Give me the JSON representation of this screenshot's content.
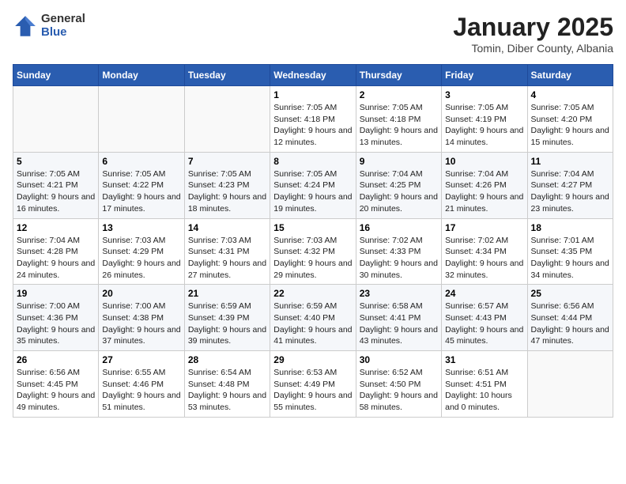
{
  "logo": {
    "general": "General",
    "blue": "Blue"
  },
  "title": "January 2025",
  "subtitle": "Tomin, Diber County, Albania",
  "headers": [
    "Sunday",
    "Monday",
    "Tuesday",
    "Wednesday",
    "Thursday",
    "Friday",
    "Saturday"
  ],
  "weeks": [
    [
      {
        "day": "",
        "info": ""
      },
      {
        "day": "",
        "info": ""
      },
      {
        "day": "",
        "info": ""
      },
      {
        "day": "1",
        "info": "Sunrise: 7:05 AM\nSunset: 4:18 PM\nDaylight: 9 hours and 12 minutes."
      },
      {
        "day": "2",
        "info": "Sunrise: 7:05 AM\nSunset: 4:18 PM\nDaylight: 9 hours and 13 minutes."
      },
      {
        "day": "3",
        "info": "Sunrise: 7:05 AM\nSunset: 4:19 PM\nDaylight: 9 hours and 14 minutes."
      },
      {
        "day": "4",
        "info": "Sunrise: 7:05 AM\nSunset: 4:20 PM\nDaylight: 9 hours and 15 minutes."
      }
    ],
    [
      {
        "day": "5",
        "info": "Sunrise: 7:05 AM\nSunset: 4:21 PM\nDaylight: 9 hours and 16 minutes."
      },
      {
        "day": "6",
        "info": "Sunrise: 7:05 AM\nSunset: 4:22 PM\nDaylight: 9 hours and 17 minutes."
      },
      {
        "day": "7",
        "info": "Sunrise: 7:05 AM\nSunset: 4:23 PM\nDaylight: 9 hours and 18 minutes."
      },
      {
        "day": "8",
        "info": "Sunrise: 7:05 AM\nSunset: 4:24 PM\nDaylight: 9 hours and 19 minutes."
      },
      {
        "day": "9",
        "info": "Sunrise: 7:04 AM\nSunset: 4:25 PM\nDaylight: 9 hours and 20 minutes."
      },
      {
        "day": "10",
        "info": "Sunrise: 7:04 AM\nSunset: 4:26 PM\nDaylight: 9 hours and 21 minutes."
      },
      {
        "day": "11",
        "info": "Sunrise: 7:04 AM\nSunset: 4:27 PM\nDaylight: 9 hours and 23 minutes."
      }
    ],
    [
      {
        "day": "12",
        "info": "Sunrise: 7:04 AM\nSunset: 4:28 PM\nDaylight: 9 hours and 24 minutes."
      },
      {
        "day": "13",
        "info": "Sunrise: 7:03 AM\nSunset: 4:29 PM\nDaylight: 9 hours and 26 minutes."
      },
      {
        "day": "14",
        "info": "Sunrise: 7:03 AM\nSunset: 4:31 PM\nDaylight: 9 hours and 27 minutes."
      },
      {
        "day": "15",
        "info": "Sunrise: 7:03 AM\nSunset: 4:32 PM\nDaylight: 9 hours and 29 minutes."
      },
      {
        "day": "16",
        "info": "Sunrise: 7:02 AM\nSunset: 4:33 PM\nDaylight: 9 hours and 30 minutes."
      },
      {
        "day": "17",
        "info": "Sunrise: 7:02 AM\nSunset: 4:34 PM\nDaylight: 9 hours and 32 minutes."
      },
      {
        "day": "18",
        "info": "Sunrise: 7:01 AM\nSunset: 4:35 PM\nDaylight: 9 hours and 34 minutes."
      }
    ],
    [
      {
        "day": "19",
        "info": "Sunrise: 7:00 AM\nSunset: 4:36 PM\nDaylight: 9 hours and 35 minutes."
      },
      {
        "day": "20",
        "info": "Sunrise: 7:00 AM\nSunset: 4:38 PM\nDaylight: 9 hours and 37 minutes."
      },
      {
        "day": "21",
        "info": "Sunrise: 6:59 AM\nSunset: 4:39 PM\nDaylight: 9 hours and 39 minutes."
      },
      {
        "day": "22",
        "info": "Sunrise: 6:59 AM\nSunset: 4:40 PM\nDaylight: 9 hours and 41 minutes."
      },
      {
        "day": "23",
        "info": "Sunrise: 6:58 AM\nSunset: 4:41 PM\nDaylight: 9 hours and 43 minutes."
      },
      {
        "day": "24",
        "info": "Sunrise: 6:57 AM\nSunset: 4:43 PM\nDaylight: 9 hours and 45 minutes."
      },
      {
        "day": "25",
        "info": "Sunrise: 6:56 AM\nSunset: 4:44 PM\nDaylight: 9 hours and 47 minutes."
      }
    ],
    [
      {
        "day": "26",
        "info": "Sunrise: 6:56 AM\nSunset: 4:45 PM\nDaylight: 9 hours and 49 minutes."
      },
      {
        "day": "27",
        "info": "Sunrise: 6:55 AM\nSunset: 4:46 PM\nDaylight: 9 hours and 51 minutes."
      },
      {
        "day": "28",
        "info": "Sunrise: 6:54 AM\nSunset: 4:48 PM\nDaylight: 9 hours and 53 minutes."
      },
      {
        "day": "29",
        "info": "Sunrise: 6:53 AM\nSunset: 4:49 PM\nDaylight: 9 hours and 55 minutes."
      },
      {
        "day": "30",
        "info": "Sunrise: 6:52 AM\nSunset: 4:50 PM\nDaylight: 9 hours and 58 minutes."
      },
      {
        "day": "31",
        "info": "Sunrise: 6:51 AM\nSunset: 4:51 PM\nDaylight: 10 hours and 0 minutes."
      },
      {
        "day": "",
        "info": ""
      }
    ]
  ]
}
